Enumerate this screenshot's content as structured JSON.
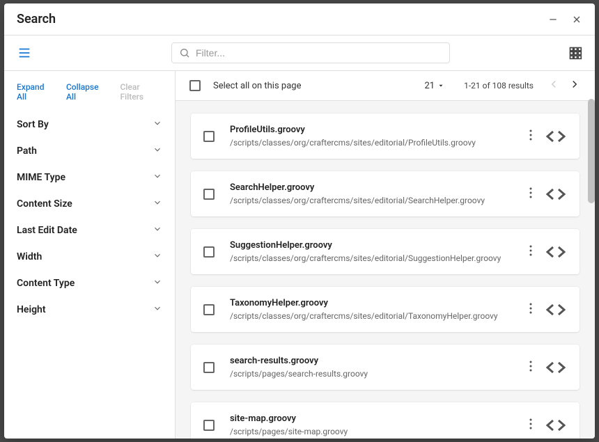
{
  "dialog": {
    "title": "Search"
  },
  "toolbar": {
    "filter_placeholder": "Filter..."
  },
  "sidebar": {
    "expand_all": "Expand All",
    "collapse_all": "Collapse All",
    "clear_filters": "Clear Filters",
    "filters": [
      {
        "label": "Sort By"
      },
      {
        "label": "Path"
      },
      {
        "label": "MIME Type"
      },
      {
        "label": "Content Size"
      },
      {
        "label": "Last Edit Date"
      },
      {
        "label": "Width"
      },
      {
        "label": "Content Type"
      },
      {
        "label": "Height"
      }
    ]
  },
  "main": {
    "select_all_label": "Select all on this page",
    "page_size": "21",
    "results_count": "1-21 of 108 results",
    "results": [
      {
        "name": "ProfileUtils.groovy",
        "path": "/scripts/classes/org/craftercms/sites/editorial/ProfileUtils.groovy"
      },
      {
        "name": "SearchHelper.groovy",
        "path": "/scripts/classes/org/craftercms/sites/editorial/SearchHelper.groovy"
      },
      {
        "name": "SuggestionHelper.groovy",
        "path": "/scripts/classes/org/craftercms/sites/editorial/SuggestionHelper.groovy"
      },
      {
        "name": "TaxonomyHelper.groovy",
        "path": "/scripts/classes/org/craftercms/sites/editorial/TaxonomyHelper.groovy"
      },
      {
        "name": "search-results.groovy",
        "path": "/scripts/pages/search-results.groovy"
      },
      {
        "name": "site-map.groovy",
        "path": "/scripts/pages/site-map.groovy"
      }
    ]
  }
}
